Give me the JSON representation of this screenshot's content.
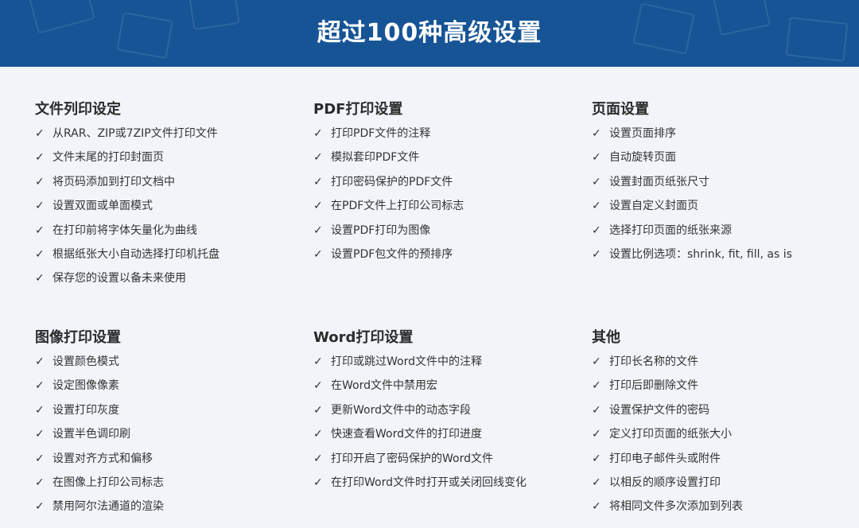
{
  "header": {
    "title": "超过100种高级设置"
  },
  "icons": {
    "item": "check-icon"
  },
  "colors": {
    "banner": "#165496",
    "background": "#f1f5f9"
  },
  "sections": [
    {
      "title": "文件列印设定",
      "items": [
        "从RAR、ZIP或7ZIP文件打印文件",
        "文件末尾的打印封面页",
        "将页码添加到打印文档中",
        "设置双面或单面模式",
        "在打印前将字体矢量化为曲线",
        "根据纸张大小自动选择打印机托盘",
        "保存您的设置以备未来使用"
      ]
    },
    {
      "title": "PDF打印设置",
      "items": [
        "打印PDF文件的注释",
        "模拟套印PDF文件",
        "打印密码保护的PDF文件",
        "在PDF文件上打印公司标志",
        "设置PDF打印为图像",
        "设置PDF包文件的预排序"
      ]
    },
    {
      "title": "页面设置",
      "items": [
        "设置页面排序",
        "自动旋转页面",
        "设置封面页纸张尺寸",
        "设置自定义封面页",
        "选择打印页面的纸张来源",
        "设置比例选项：shrink, fit, fill, as is"
      ]
    },
    {
      "title": "图像打印设置",
      "items": [
        "设置颜色模式",
        "设定图像像素",
        "设置打印灰度",
        "设置半色调印刷",
        "设置对齐方式和偏移",
        "在图像上打印公司标志",
        "禁用阿尔法通道的渲染"
      ]
    },
    {
      "title": "Word打印设置",
      "items": [
        "打印或跳过Word文件中的注释",
        "在Word文件中禁用宏",
        "更新Word文件中的动态字段",
        "快速查看Word文件的打印进度",
        "打印开启了密码保护的Word文件",
        "在打印Word文件时打开或关闭回线变化"
      ]
    },
    {
      "title": "其他",
      "items": [
        "打印长名称的文件",
        "打印后即删除文件",
        "设置保护文件的密码",
        "定义打印页面的纸张大小",
        "打印电子邮件头或附件",
        "以相反的顺序设置打印",
        "将相同文件多次添加到列表"
      ]
    }
  ]
}
